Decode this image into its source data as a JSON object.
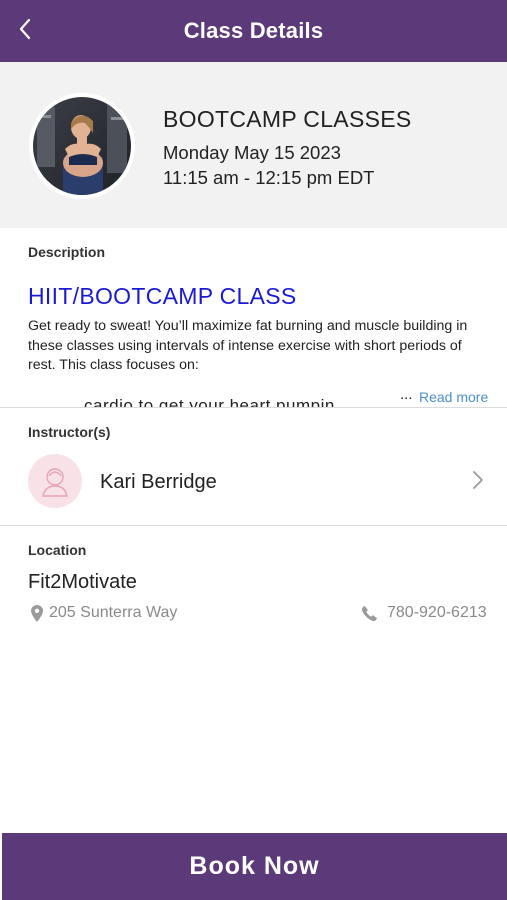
{
  "header": {
    "title": "Class Details",
    "back_icon": "chevron-left-icon"
  },
  "class_info": {
    "name": "BOOTCAMP CLASSES",
    "date": "Monday May 15 2023",
    "time": "11:15 am - 12:15 pm EDT"
  },
  "description": {
    "label": "Description",
    "heading": "HIIT/BOOTCAMP CLASS",
    "body": "Get ready to sweat! You’ll maximize fat burning and muscle building in these classes using intervals of intense exercise with short periods of rest. This class focuses on:",
    "truncated_line": "cardio to get your heart pumpin",
    "ellipsis": "...",
    "read_more": "Read more"
  },
  "instructor": {
    "label": "Instructor(s)",
    "name": "Kari Berridge"
  },
  "location": {
    "label": "Location",
    "name": "Fit2Motivate",
    "address": "205 Sunterra Way",
    "phone": "780-920-6213"
  },
  "actions": {
    "book_now": "Book Now"
  },
  "colors": {
    "brand_purple": "#5c3a7a",
    "link_blue": "#4a8fd0",
    "heading_blue": "#1a1ad6",
    "summary_bg": "#f2f2f2",
    "avatar_pink": "#f9e1e8"
  }
}
